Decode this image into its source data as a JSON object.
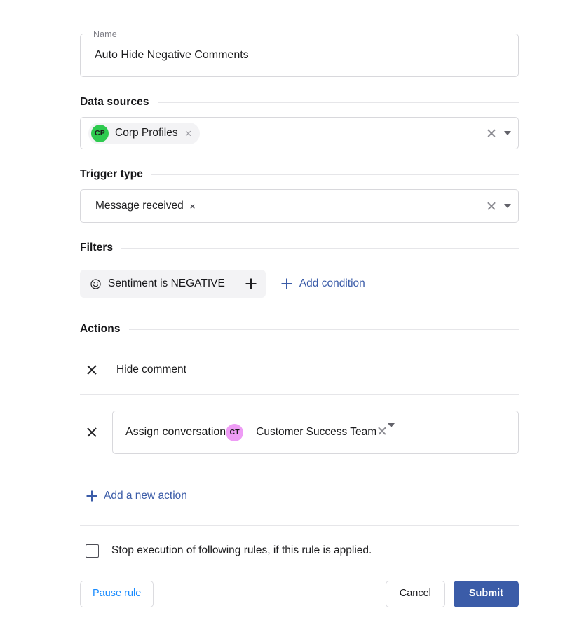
{
  "name_field": {
    "label": "Name",
    "value": "Auto Hide Negative Comments"
  },
  "sections": {
    "data_sources": "Data sources",
    "trigger_type": "Trigger type",
    "filters": "Filters",
    "actions": "Actions"
  },
  "data_sources": {
    "chip": {
      "avatar_initials": "CP",
      "avatar_color": "#2eca4f",
      "label": "Corp Profiles",
      "remove": "×"
    }
  },
  "trigger_type": {
    "chip": {
      "label": "Message received",
      "remove": "×"
    }
  },
  "filters": {
    "condition": {
      "icon": "sentiment-smiley-icon",
      "label": "Sentiment is NEGATIVE"
    },
    "add_condition_label": "Add condition"
  },
  "actions": {
    "items": [
      {
        "label": "Hide comment"
      }
    ],
    "assign": {
      "legend": "Assign conversation",
      "avatar_initials": "CT",
      "avatar_color": "#ee9cf5",
      "value": "Customer Success Team"
    },
    "add_action_label": "Add a new action"
  },
  "stop_execution": {
    "label": "Stop execution of following rules, if this rule is applied.",
    "checked": false
  },
  "footer": {
    "pause_label": "Pause rule",
    "cancel_label": "Cancel",
    "submit_label": "Submit"
  },
  "theme": {
    "link_blue": "#3b5ca8",
    "pause_blue": "#1a8cff",
    "submit_bg": "#3b5ca8",
    "border": "#d8d8dc",
    "divider": "#e6e6e9",
    "chip_bg": "#f3f3f5"
  }
}
